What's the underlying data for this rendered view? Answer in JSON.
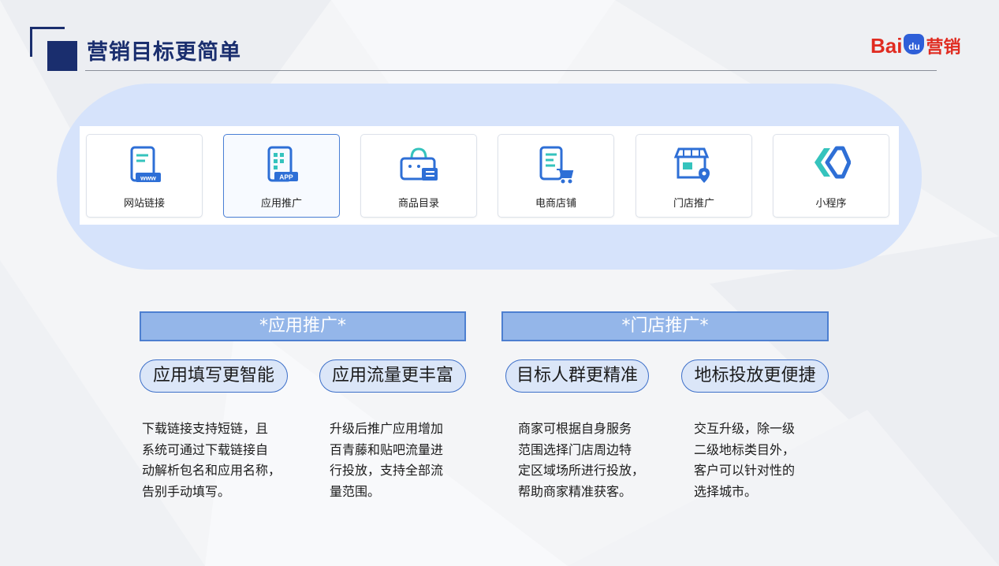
{
  "header": {
    "title": "营销目标更简单",
    "brand": {
      "latin_prefix": "Bai",
      "paw_text": "du",
      "chinese": "营销"
    }
  },
  "targets": [
    {
      "label": "网站链接",
      "icon": "website-link-icon",
      "icon_badge": "www"
    },
    {
      "label": "应用推广",
      "icon": "app-promotion-icon",
      "icon_badge": "APP",
      "selected": true
    },
    {
      "label": "商品目录",
      "icon": "product-catalog-icon"
    },
    {
      "label": "电商店铺",
      "icon": "ecommerce-store-icon"
    },
    {
      "label": "门店推广",
      "icon": "store-promotion-icon"
    },
    {
      "label": "小程序",
      "icon": "mini-program-icon"
    }
  ],
  "sections": [
    {
      "title": "*应用推广*",
      "features": [
        {
          "heading": "应用填写更智能",
          "text": "下载链接支持短链，且\n系统可通过下载链接自\n动解析包名和应用名称，\n告别手动填写。"
        },
        {
          "heading": "应用流量更丰富",
          "text": "升级后推广应用增加\n百青藤和贴吧流量进\n行投放，支持全部流\n量范围。"
        }
      ]
    },
    {
      "title": "*门店推广*",
      "features": [
        {
          "heading": "目标人群更精准",
          "text": "商家可根据自身服务\n范围选择门店周边特\n定区域场所进行投放，\n帮助商家精准获客。"
        },
        {
          "heading": "地标投放更便捷",
          "text": "交互升级，除一级\n二级地标类目外，\n客户可以针对性的\n选择城市。"
        }
      ]
    }
  ],
  "colors": {
    "navy": "#1a2e6e",
    "accent": "#2e6fd6",
    "teal": "#35c3bd",
    "capsule": "#d6e3fb",
    "brand_red": "#e02b20"
  }
}
